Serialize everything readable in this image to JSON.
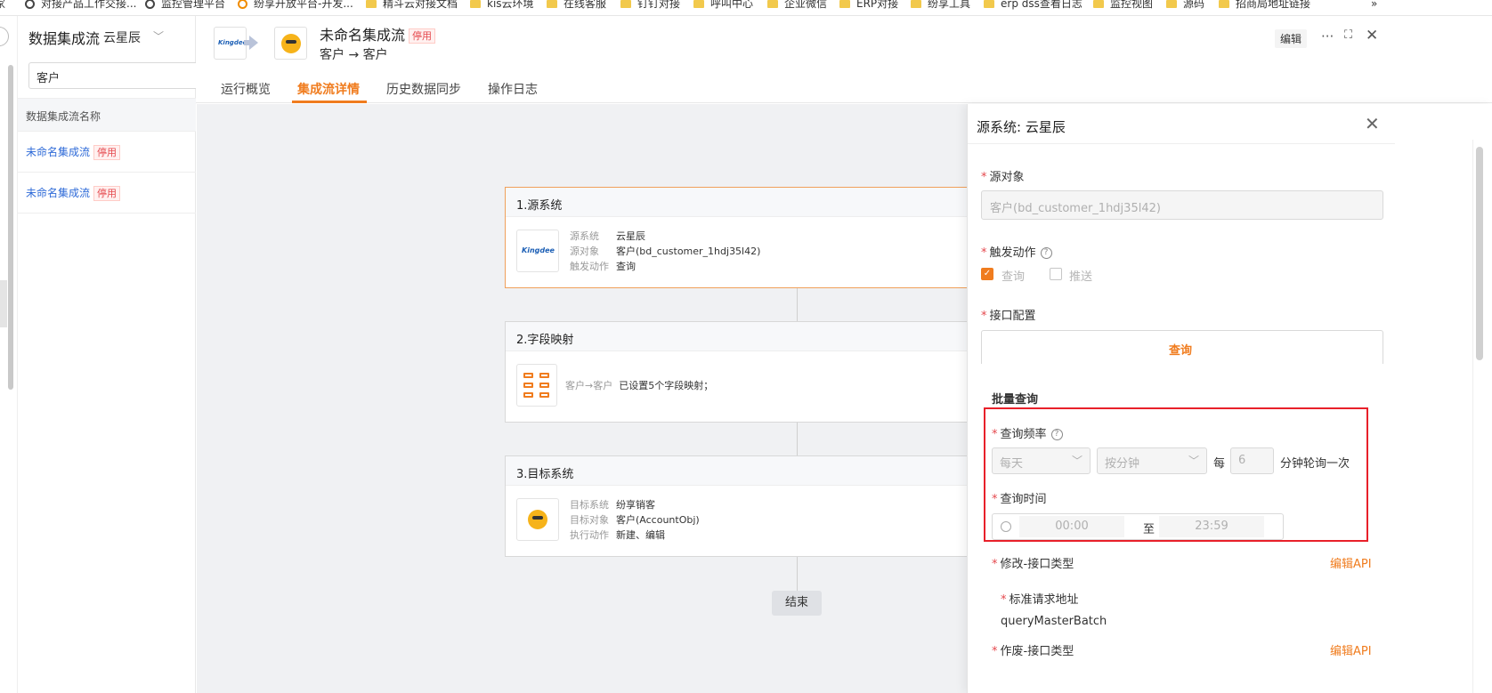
{
  "bookmarks": [
    {
      "label": "家",
      "icon": "none"
    },
    {
      "label": "对接产品工作交接...",
      "icon": "globe-icon"
    },
    {
      "label": "监控管理平台",
      "icon": "globe-icon"
    },
    {
      "label": "纷享开放平台-开发...",
      "icon": "orange-globe-icon"
    },
    {
      "label": "精斗云对接文档",
      "icon": "folder-icon"
    },
    {
      "label": "kis云环境",
      "icon": "folder-icon"
    },
    {
      "label": "在线客服",
      "icon": "folder-icon"
    },
    {
      "label": "钉钉对接",
      "icon": "folder-icon"
    },
    {
      "label": "呼叫中心",
      "icon": "folder-icon"
    },
    {
      "label": "企业微信",
      "icon": "folder-icon"
    },
    {
      "label": "ERP对接",
      "icon": "folder-icon"
    },
    {
      "label": "纷享工具",
      "icon": "folder-icon"
    },
    {
      "label": "erp dss查看日志",
      "icon": "folder-icon"
    },
    {
      "label": "监控视图",
      "icon": "folder-icon"
    },
    {
      "label": "源码",
      "icon": "folder-icon"
    },
    {
      "label": "招商局地址链接",
      "icon": "folder-icon"
    }
  ],
  "bookmarks_overflow": "»",
  "list": {
    "title": "数据集成流",
    "subtitle": "云星辰",
    "search_value": "客户",
    "column_header": "数据集成流名称",
    "rows": [
      {
        "name": "未命名集成流",
        "status": "停用"
      },
      {
        "name": "未命名集成流",
        "status": "停用"
      }
    ]
  },
  "header": {
    "source_logo_text": "Kingdee",
    "flow_title": "未命名集成流",
    "status": "停用",
    "route": "客户 → 客户",
    "edit_label": "编辑",
    "more_icon": "···",
    "fullscreen_icon": "⛶",
    "close_icon": "✕"
  },
  "tabs": [
    {
      "label": "运行概览",
      "active": false
    },
    {
      "label": "集成流详情",
      "active": true
    },
    {
      "label": "历史数据同步",
      "active": false
    },
    {
      "label": "操作日志",
      "active": false
    }
  ],
  "flow": {
    "source": {
      "title": "1.源系统",
      "logo_text": "Kingdee",
      "rows": [
        {
          "k": "源系统",
          "v": "云星辰"
        },
        {
          "k": "源对象",
          "v": "客户(bd_customer_1hdj35l42)"
        },
        {
          "k": "触发动作",
          "v": "查询"
        }
      ]
    },
    "mapping": {
      "title": "2.字段映射",
      "route": "客户→客户",
      "summary": "已设置5个字段映射；"
    },
    "target": {
      "title": "3.目标系统",
      "rows": [
        {
          "k": "目标系统",
          "v": "纷享销客"
        },
        {
          "k": "目标对象",
          "v": "客户(AccountObj)"
        },
        {
          "k": "执行动作",
          "v": "新建、编辑"
        }
      ]
    },
    "end_label": "结束"
  },
  "drawer": {
    "title": "源系统: 云星辰",
    "close_icon": "✕",
    "source_object_label": "源对象",
    "source_object_value": "客户(bd_customer_1hdj35l42)",
    "trigger_label": "触发动作",
    "trigger_options": [
      {
        "label": "查询",
        "checked": true
      },
      {
        "label": "推送",
        "checked": false
      }
    ],
    "interface_label": "接口配置",
    "interface_tab": "查询",
    "batch_query_label": "批量查询",
    "frequency_label": "查询频率",
    "frequency_unit1": "每天",
    "frequency_unit2": "按分钟",
    "every_label": "每",
    "minutes_value": "6",
    "minutes_suffix": "分钟轮询一次",
    "time_label": "查询时间",
    "time_start": "00:00",
    "time_to": "至",
    "time_end": "23:59",
    "modify_label": "修改-接口类型",
    "edit_api_1": "编辑API",
    "standard_url_label": "标准请求地址",
    "standard_url_value": "queryMasterBatch",
    "invalid_label": "作废-接口类型",
    "edit_api_2": "编辑API"
  },
  "colors": {
    "accent": "#f07c1e",
    "link": "#2f6bd8",
    "danger": "#e5484d",
    "highlight_box": "#e8202a"
  }
}
